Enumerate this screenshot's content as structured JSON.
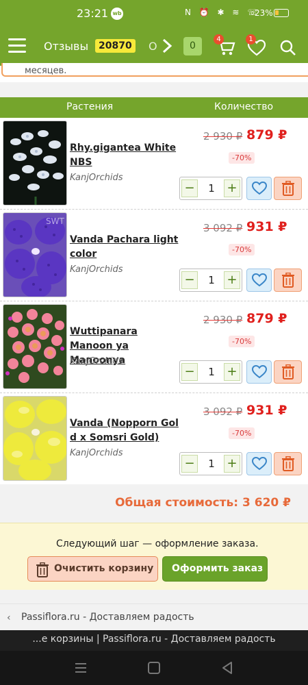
{
  "status_bar": {
    "time": "23:21",
    "app_badge": "wb",
    "battery": "23%",
    "indicators": "N ⏰ ✱ ≋ ☏"
  },
  "header": {
    "reviews_label": "Отзывы",
    "reviews_count": "20870",
    "cut_text": "О",
    "compare_count": "0",
    "cart_count": "4",
    "favorites_count": "1",
    "brand_color": "#75a52c"
  },
  "info_fragment": "месяцев.",
  "table": {
    "col_plants": "Растения",
    "col_quantity": "Количество"
  },
  "items": [
    {
      "name": "Rhy.gigantea White NBS",
      "seller": "KanjOrchids",
      "old_price": "2 930 ₽",
      "price": "879 ₽",
      "discount": "-70%",
      "quantity": "1",
      "photo": "white-orchid"
    },
    {
      "name": "Vanda Pachara light color",
      "seller": "KanjOrchids",
      "old_price": "3 092 ₽",
      "price": "931 ₽",
      "discount": "-70%",
      "quantity": "1",
      "photo": "violet-orchid",
      "photo_watermark": "SWT"
    },
    {
      "name": "Wuttipanara Manoon ya Manoonya",
      "seller": "KanjOrchids",
      "old_price": "2 930 ₽",
      "price": "879 ₽",
      "discount": "-70%",
      "quantity": "1",
      "photo": "pink-orchid"
    },
    {
      "name": "Vanda (Nopporn Gol d x Somsri Gold)",
      "seller": "KanjOrchids",
      "old_price": "3 092 ₽",
      "price": "931 ₽",
      "discount": "-70%",
      "quantity": "1",
      "photo": "yellow-orchid"
    }
  ],
  "qty_controls": {
    "minus": "−",
    "plus": "+"
  },
  "total": "Общая стоимость: 3 620 ₽",
  "checkout": {
    "next_step": "Следующий шаг — оформление заказа.",
    "clear_cart": "Очистить корзину",
    "place_order": "Оформить заказ"
  },
  "breadcrumb": {
    "back": "‹",
    "title": "Passiflora.ru - Доставляем радость"
  },
  "browser_tab": "...е корзины | Passiflora.ru - Доставляем радость",
  "nav_icons": [
    "recents-icon",
    "home-icon",
    "back-icon"
  ]
}
